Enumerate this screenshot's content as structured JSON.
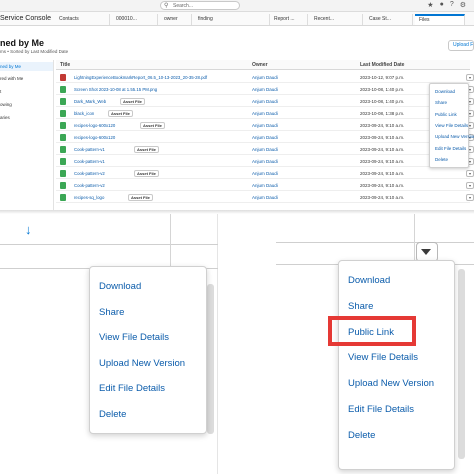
{
  "browser": {
    "search_placeholder": "Search...",
    "icons": [
      "star-icon",
      "bell-icon",
      "help-icon",
      "gear-icon"
    ]
  },
  "console": {
    "app_name": "Service Console",
    "tabs": [
      {
        "label": "Contacts",
        "active": false
      },
      {
        "label": "000010...",
        "active": false
      },
      {
        "label": "owner",
        "active": false
      },
      {
        "label": "finding",
        "active": false
      },
      {
        "label": "Report ...",
        "active": false
      },
      {
        "label": "Recent...",
        "active": false
      },
      {
        "label": "Case St...",
        "active": false
      },
      {
        "label": "Files",
        "active": true
      }
    ]
  },
  "page": {
    "title": "ned by Me",
    "subtitle": "ms • Sorted by Last Modified Date",
    "upload_label": "Upload Fi"
  },
  "sidebar": {
    "items": [
      {
        "label": "ned by Me",
        "active": true
      },
      {
        "label": "red with Me",
        "active": false
      },
      {
        "label": "t",
        "active": false
      },
      {
        "label": "owing",
        "active": false
      },
      {
        "label": "aries",
        "active": false
      }
    ]
  },
  "table": {
    "headers": {
      "title": "Title",
      "owner": "Owner",
      "modified": "Last Modified Date"
    },
    "asset_badge": "Asset File",
    "rows": [
      {
        "name": "LightningExperienceBookmarkReport_06.5_10-13-2023_20-35-28.pdf",
        "asset": false,
        "owner": "Anjum Daudi",
        "modified": "2023-10-12, 9:07 p.m.",
        "icon_color": "#c23934"
      },
      {
        "name": "Screen Shot 2023-10-08 at 1.55.15 PM.png",
        "asset": false,
        "owner": "Anjum Daudi",
        "modified": "2023-10-08, 1:40 p.m.",
        "icon_color": "#3ba755"
      },
      {
        "name": "Dark_Mark_Web",
        "asset": true,
        "owner": "Anjum Daudi",
        "modified": "2023-10-08, 1:40 p.m.",
        "icon_color": "#3ba755"
      },
      {
        "name": "black_icon",
        "asset": true,
        "owner": "Anjum Daudi",
        "modified": "2023-10-08, 1:38 p.m.",
        "icon_color": "#3ba755"
      },
      {
        "name": "recipes-logo-600x120",
        "asset": true,
        "owner": "Anjum Daudi",
        "modified": "2023-09-24, 9:10 a.m.",
        "icon_color": "#3ba755"
      },
      {
        "name": "recipes-logo-600x120",
        "asset": false,
        "owner": "Anjum Daudi",
        "modified": "2023-09-24, 9:10 a.m.",
        "icon_color": "#3ba755"
      },
      {
        "name": "Cook-pattern-v1",
        "asset": true,
        "owner": "Anjum Daudi",
        "modified": "2023-09-24, 9:10 a.m.",
        "icon_color": "#3ba755"
      },
      {
        "name": "Cook-pattern-v1",
        "asset": false,
        "owner": "Anjum Daudi",
        "modified": "2023-09-24, 9:10 a.m.",
        "icon_color": "#3ba755"
      },
      {
        "name": "Cook-pattern-v2",
        "asset": true,
        "owner": "Anjum Daudi",
        "modified": "2023-09-24, 9:10 a.m.",
        "icon_color": "#3ba755"
      },
      {
        "name": "Cook-pattern-v2",
        "asset": false,
        "owner": "Anjum Daudi",
        "modified": "2023-09-24, 9:10 a.m.",
        "icon_color": "#3ba755"
      },
      {
        "name": "recipes-sq_logo",
        "asset": true,
        "owner": "Anjum Daudi",
        "modified": "2023-09-24, 9:10 a.m.",
        "icon_color": "#3ba755"
      }
    ]
  },
  "mini_menu": {
    "items": [
      "Download",
      "Share",
      "Public Link",
      "View File Details",
      "Upload New Version",
      "Edit File Details",
      "Delete"
    ]
  },
  "zoom_left": {
    "items": [
      "Download",
      "Share",
      "View File Details",
      "Upload New Version",
      "Edit File Details",
      "Delete"
    ]
  },
  "zoom_right": {
    "items": [
      "Download",
      "Share",
      "Public Link",
      "View File Details",
      "Upload New Version",
      "Edit File Details",
      "Delete"
    ],
    "highlighted": "Public Link",
    "highlight_color": "#e53935"
  },
  "colors": {
    "accent": "#0176d3",
    "link": "#0b5cab"
  }
}
